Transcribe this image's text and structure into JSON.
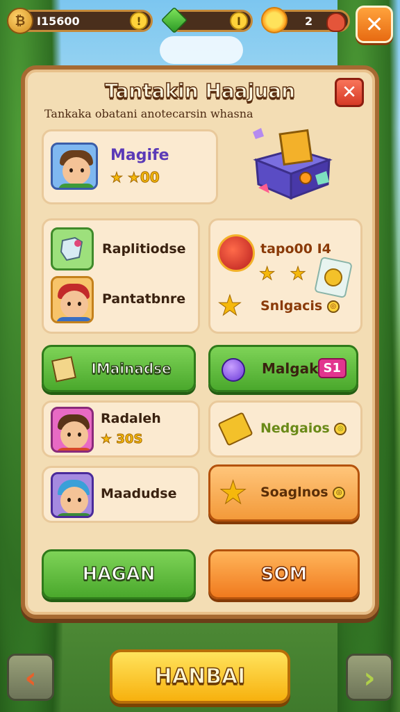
{
  "hud": {
    "coins": "I15600",
    "coin_icon_glyph": "₿",
    "plus_glyph": "!",
    "gem_count": "",
    "gem_plus_glyph": "I",
    "stars": "2",
    "close_glyph": "✕"
  },
  "panel": {
    "title": "Tantakin Haajuan",
    "subtitle": "Tankaka obatani anotecarsin whasna",
    "close_glyph": "✕"
  },
  "profile": {
    "name": "Magife",
    "stars_value": "★ ★00"
  },
  "rewards": {
    "left_card": {
      "item1_label": "Raplitiodse",
      "item2_label": "Pantatbnre"
    },
    "right_card": {
      "title": "tapo00 I4",
      "stars": "★ ★",
      "footer": "Snlgacis"
    }
  },
  "actions": {
    "green_action_label": "IMainadse",
    "purple_action_label": "Malgak",
    "purple_action_badge": "S1"
  },
  "players": [
    {
      "name": "Radaleh",
      "score": "★ 30S"
    },
    {
      "name": "Maadudse"
    }
  ],
  "side_rewards": [
    {
      "label": "Nedgaios"
    },
    {
      "label": "Soaglnos"
    }
  ],
  "buttons": {
    "left": "HAGAN",
    "right": "SOM",
    "bottom": "HANBAI",
    "prev_glyph": "‹",
    "next_glyph": "›"
  },
  "colors": {
    "panel": "#f3ddb4",
    "panel_border": "#a66a32",
    "green": "#4aa82c",
    "orange": "#f07a1e",
    "yellow": "#f7b10e"
  }
}
